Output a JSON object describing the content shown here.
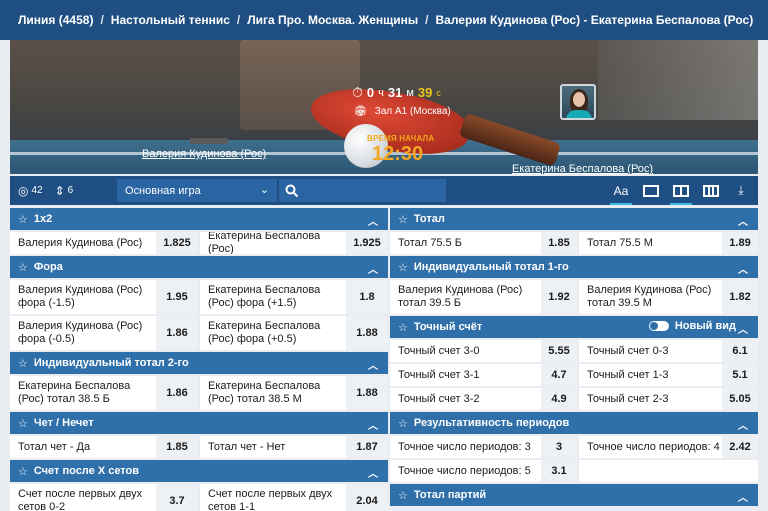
{
  "breadcrumb": [
    "Линия (4458)",
    "Настольный теннис",
    "Лига Про. Москва. Женщины",
    "Валерия Кудинова (Рос) - Екатерина Беспалова (Рос)"
  ],
  "hero": {
    "timer_hours": "0",
    "timer_hours_unit": "ч",
    "timer_minutes": "31",
    "timer_minutes_unit": "м",
    "timer_seconds": "39",
    "timer_seconds_unit": "с",
    "venue": "Зал А1 (Москва)",
    "start_label": "ВРЕМЯ НАЧАЛА",
    "start_time": "12:30",
    "team1": "Валерия Кудинова (Рос)",
    "team2": "Екатерина Беспалова (Рос)"
  },
  "toolbar": {
    "count1": "42",
    "count2": "6",
    "market_select": "Основная игра",
    "font_toggle": "Aa",
    "colors": {
      "bar": "#1f4e82",
      "group": "#2f6faa",
      "accent": "#f5a623"
    }
  },
  "left": {
    "g1": {
      "title": "1x2",
      "rows": [
        [
          {
            "name": "Валерия Кудинова (Рос)",
            "odd": "1.825"
          },
          {
            "name": "Екатерина Беспалова (Рос)",
            "odd": "1.925"
          }
        ]
      ]
    },
    "g2": {
      "title": "Фора",
      "rows": [
        [
          {
            "name": "Валерия Кудинова (Рос) фора (-1.5)",
            "odd": "1.95"
          },
          {
            "name": "Екатерина Беспалова (Рос) фора (+1.5)",
            "odd": "1.8"
          }
        ],
        [
          {
            "name": "Валерия Кудинова (Рос) фора (-0.5)",
            "odd": "1.86"
          },
          {
            "name": "Екатерина Беспалова (Рос) фора (+0.5)",
            "odd": "1.88"
          }
        ]
      ]
    },
    "g3": {
      "title": "Индивидуальный тотал 2-го",
      "rows": [
        [
          {
            "name": "Екатерина Беспалова (Рос) тотал 38.5 Б",
            "odd": "1.86"
          },
          {
            "name": "Екатерина Беспалова (Рос) тотал 38.5 М",
            "odd": "1.88"
          }
        ]
      ]
    },
    "g4": {
      "title": "Чет / Нечет",
      "rows": [
        [
          {
            "name": "Тотал чет - Да",
            "odd": "1.85"
          },
          {
            "name": "Тотал чет - Нет",
            "odd": "1.87"
          }
        ]
      ]
    },
    "g5": {
      "title": "Счет после X сетов",
      "rows": [
        [
          {
            "name": "Счет после первых двух сетов 0-2",
            "odd": "3.7"
          },
          {
            "name": "Счет после первых двух сетов 1-1",
            "odd": "2.04"
          }
        ]
      ]
    }
  },
  "right": {
    "g1": {
      "title": "Тотал",
      "rows": [
        [
          {
            "name": "Тотал 75.5 Б",
            "odd": "1.85"
          },
          {
            "name": "Тотал 75.5 М",
            "odd": "1.89"
          }
        ]
      ]
    },
    "g2": {
      "title": "Индивидуальный тотал 1-го",
      "rows": [
        [
          {
            "name": "Валерия Кудинова (Рос) тотал 39.5 Б",
            "odd": "1.92"
          },
          {
            "name": "Валерия Кудинова (Рос) тотал 39.5 М",
            "odd": "1.82"
          }
        ]
      ]
    },
    "g3": {
      "title": "Точный счёт",
      "toggle_label": "Новый вид",
      "rows": [
        [
          {
            "name": "Точный счет 3-0",
            "odd": "5.55"
          },
          {
            "name": "Точный счет 0-3",
            "odd": "6.1"
          }
        ],
        [
          {
            "name": "Точный счет 3-1",
            "odd": "4.7"
          },
          {
            "name": "Точный счет 1-3",
            "odd": "5.1"
          }
        ],
        [
          {
            "name": "Точный счет 3-2",
            "odd": "4.9"
          },
          {
            "name": "Точный счет 2-3",
            "odd": "5.05"
          }
        ]
      ]
    },
    "g4": {
      "title": "Результативность периодов",
      "rows": [
        [
          {
            "name": "Точное число периодов: 3",
            "odd": "3"
          },
          {
            "name": "Точное число периодов: 4",
            "odd": "2.42"
          }
        ],
        [
          {
            "name": "Точное число периодов: 5",
            "odd": "3.1"
          }
        ]
      ]
    },
    "g5": {
      "title": "Тотал партий"
    }
  }
}
